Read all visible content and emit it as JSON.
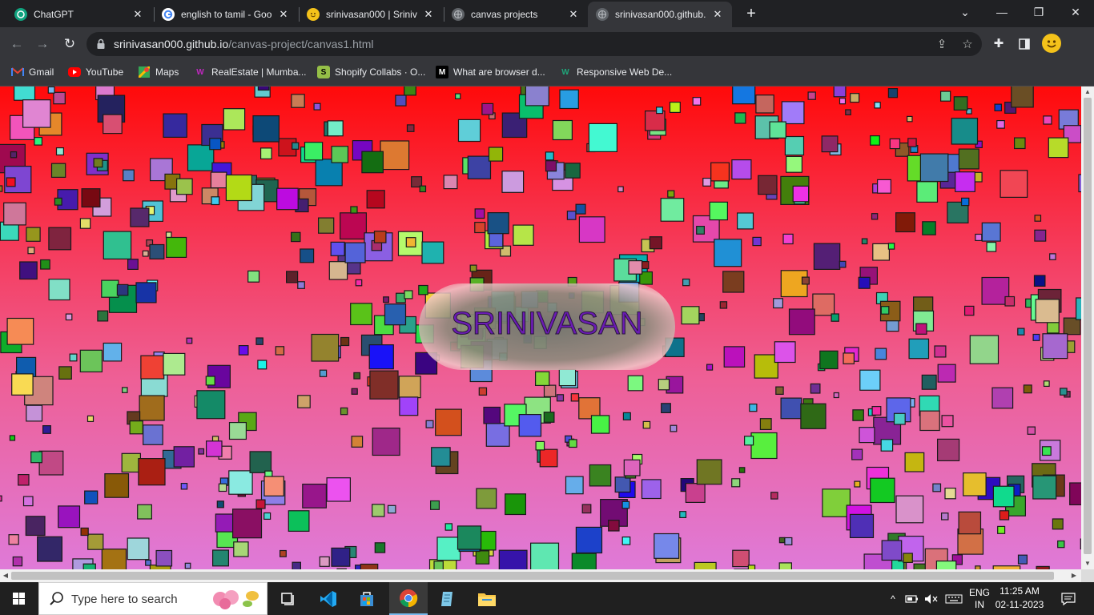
{
  "browser": {
    "tabs": [
      {
        "title": "ChatGPT",
        "icon": "chatgpt-icon",
        "active": false
      },
      {
        "title": "english to tamil - Goo",
        "icon": "google-icon",
        "active": false
      },
      {
        "title": "srinivasan000 | Sriniv",
        "icon": "emoji-face-icon",
        "active": false
      },
      {
        "title": "canvas projects",
        "icon": "globe-icon",
        "active": false
      },
      {
        "title": "srinivasan000.github.",
        "icon": "globe-icon",
        "active": true
      }
    ],
    "address": {
      "host": "srinivasan000.github.io",
      "path": "/canvas-project/canvas1.html"
    },
    "bookmarks": [
      {
        "label": "Gmail",
        "icon": "gmail-icon"
      },
      {
        "label": "YouTube",
        "icon": "youtube-icon"
      },
      {
        "label": "Maps",
        "icon": "maps-icon"
      },
      {
        "label": "RealEstate | Mumba...",
        "icon": "realestate-icon"
      },
      {
        "label": "Shopify Collabs · O...",
        "icon": "shopify-icon"
      },
      {
        "label": "What are browser d...",
        "icon": "medium-icon"
      },
      {
        "label": "Responsive Web De...",
        "icon": "webflow-icon"
      }
    ]
  },
  "canvas": {
    "heading": "SRINIVASAN",
    "colors": {
      "top": "#ff0a0a",
      "middle": "#f53d5f",
      "bottom": "#df7ad8",
      "text": "#6a1bb3"
    }
  },
  "taskbar": {
    "search_placeholder": "Type here to search",
    "language": "ENG",
    "region": "IN",
    "time": "11:25 AM",
    "date": "02-11-2023"
  }
}
